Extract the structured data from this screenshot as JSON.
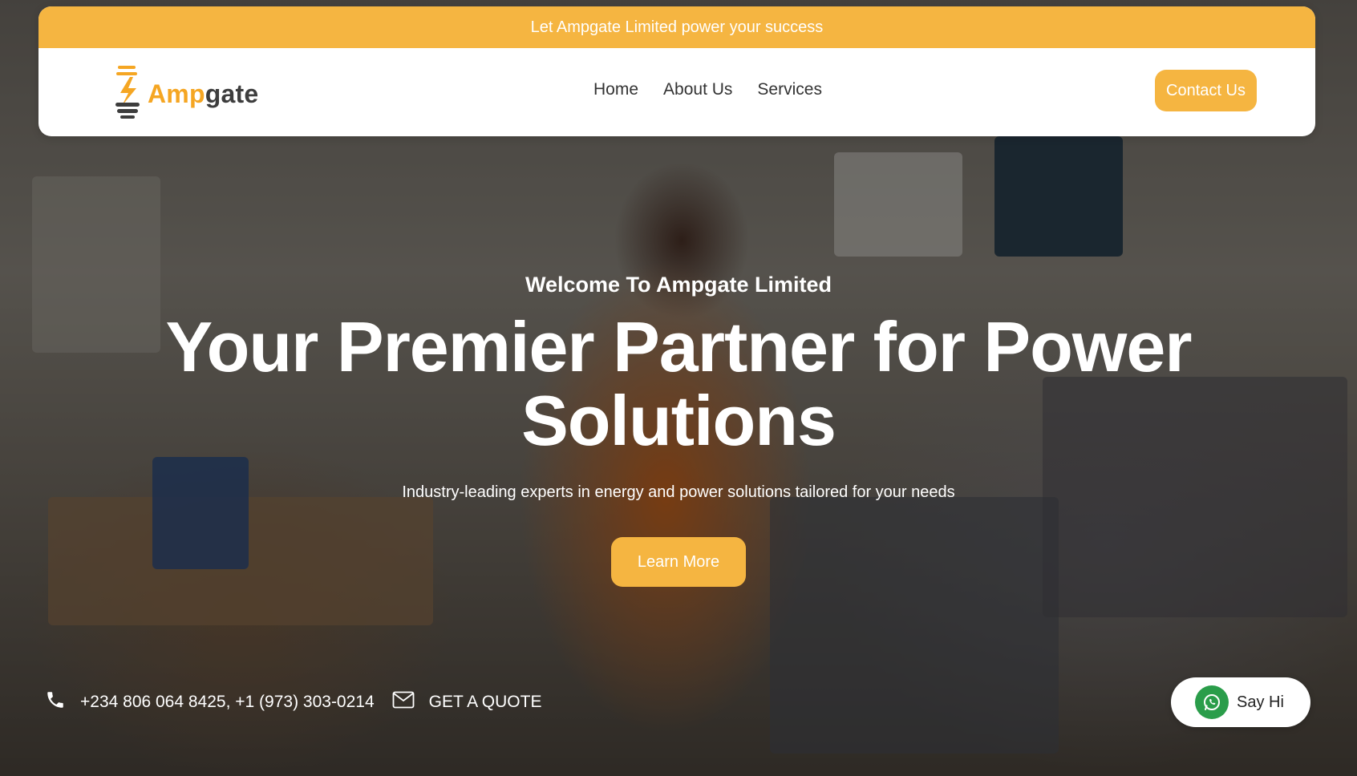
{
  "colors": {
    "brand": "#f5b541",
    "logo_accent": "#f5a623",
    "logo_dark": "#3d3d3d",
    "whatsapp": "#2a9d4a"
  },
  "announcement": "Let Ampgate Limited power your success",
  "logo": {
    "text_accent": "Amp",
    "text_dark": "gate",
    "icon": "lightning-bulb-icon"
  },
  "nav": {
    "links": [
      "Home",
      "About Us",
      "Services"
    ],
    "contact_label": "Contact Us"
  },
  "hero": {
    "eyebrow": "Welcome To Ampgate Limited",
    "headline_line1": "Your Premier Partner for Power",
    "headline_line2": "Solutions",
    "subline": "Industry-leading experts in energy and power solutions tailored for your needs",
    "cta_label": "Learn More"
  },
  "bottom_bar": {
    "phone_icon": "phone-icon",
    "phones": "+234 806 064 8425, +1 (973) 303-0214",
    "mail_icon": "mail-icon",
    "quote_label": "GET A QUOTE"
  },
  "chat": {
    "icon": "whatsapp-icon",
    "label": "Say Hi"
  }
}
